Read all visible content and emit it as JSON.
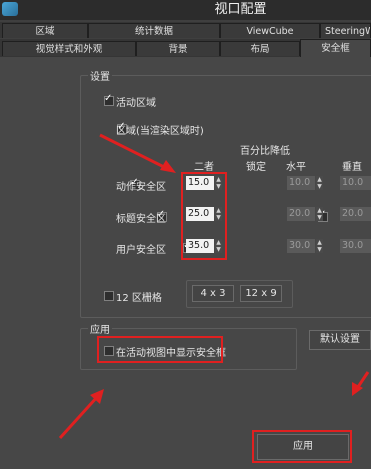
{
  "window": {
    "title": "视口配置"
  },
  "tabs_row1": [
    {
      "label": "区域"
    },
    {
      "label": "统计数据"
    },
    {
      "label": "ViewCube"
    },
    {
      "label": "SteeringWheels"
    }
  ],
  "tabs_row2": [
    {
      "label": "视觉样式和外观"
    },
    {
      "label": "背景"
    },
    {
      "label": "布局"
    },
    {
      "label": "安全框"
    }
  ],
  "settings": {
    "group_label": "设置",
    "live_area": "活动区域",
    "region": "区域(当渲染区域时)",
    "header_percent": "百分比降低",
    "header_both": "二者",
    "header_lock": "锁定",
    "header_horizontal": "水平",
    "header_vertical": "垂直",
    "rows": [
      {
        "label": "动作安全区",
        "both": "15.0",
        "h": "10.0",
        "v": "10.0"
      },
      {
        "label": "标题安全区",
        "both": "25.0",
        "h": "20.0",
        "v": "20.0"
      },
      {
        "label": "用户安全区",
        "both": "35.0",
        "h": "30.0",
        "v": "30.0"
      }
    ],
    "grid_label": "12 区栅格",
    "grid_4x3": "4 x 3",
    "grid_12x9": "12 x 9"
  },
  "application": {
    "group_label": "应用",
    "show_safe_frame": "在活动视图中显示安全框"
  },
  "buttons": {
    "default": "默认设置",
    "apply": "应用"
  },
  "colors": {
    "annotation": "#e02020",
    "panel": "#474747"
  }
}
